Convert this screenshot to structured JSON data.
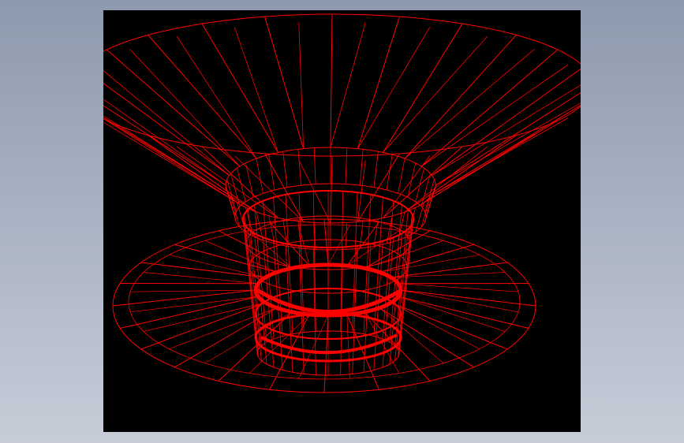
{
  "app": {
    "background_top": "#8d99ad",
    "background_bottom": "#c7ccd8"
  },
  "viewport": {
    "background": "#000000",
    "wire_color": "#ff0000",
    "model": "wireframe-flanged-cylinder"
  }
}
